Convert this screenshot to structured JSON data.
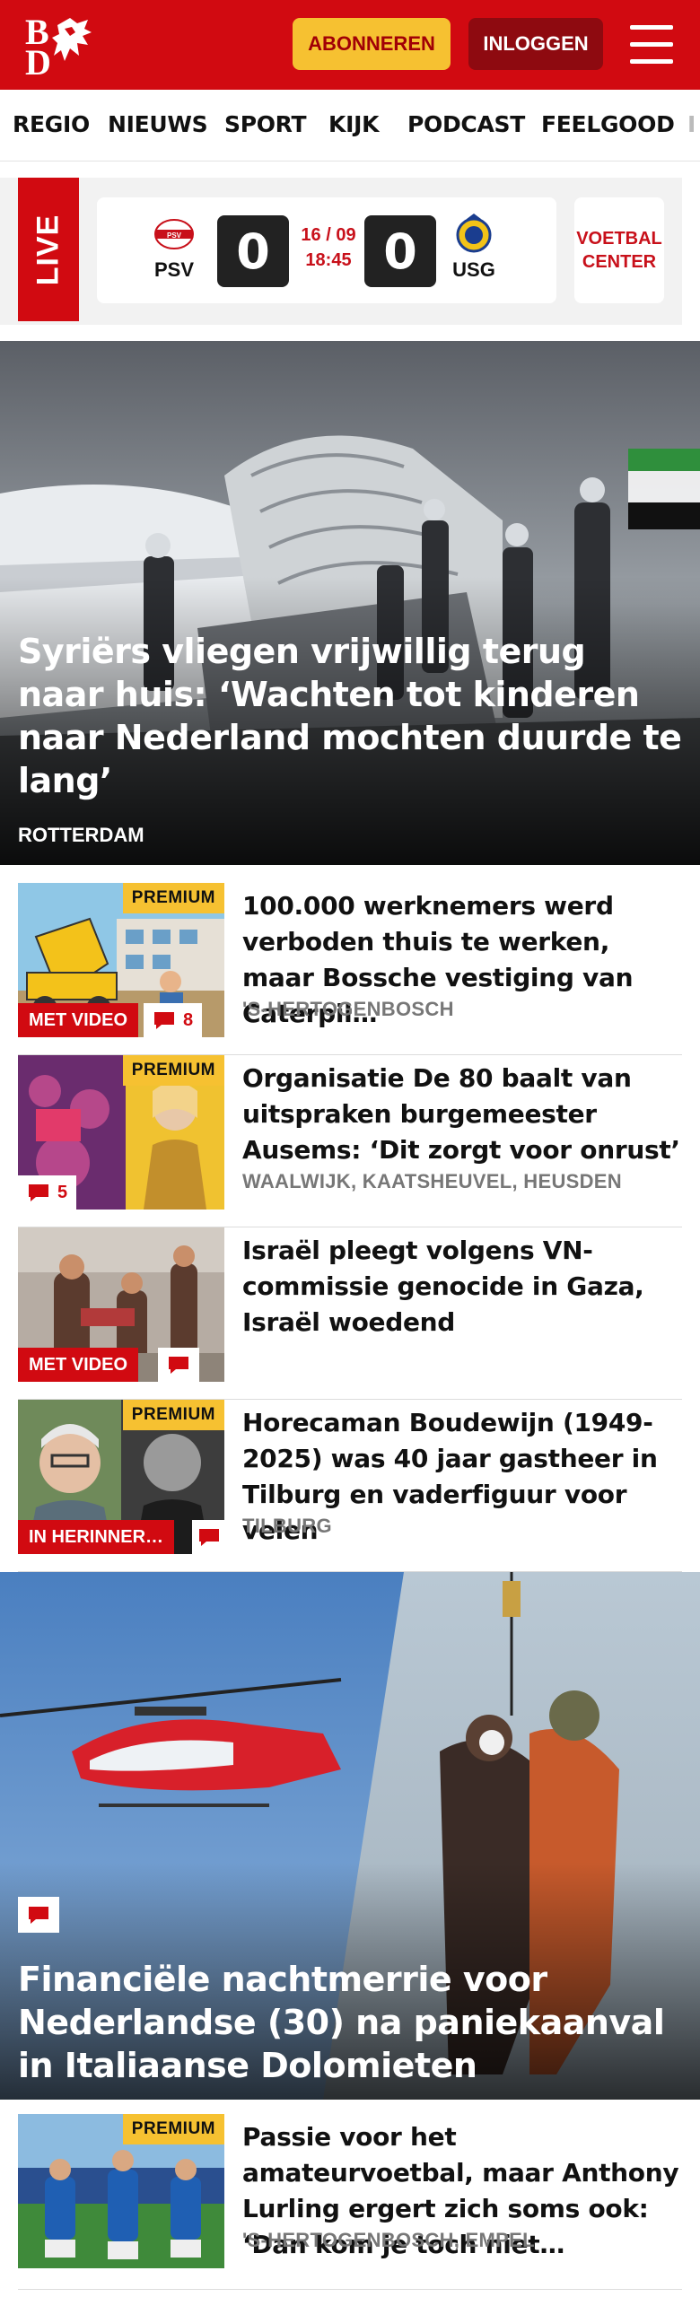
{
  "header": {
    "logo_text": "BD",
    "subscribe_label": "ABONNEREN",
    "login_label": "INLOGGEN"
  },
  "nav": {
    "items": [
      "REGIO",
      "NIEUWS",
      "SPORT",
      "KIJK",
      "PODCAST",
      "FEELGOOD",
      "I"
    ]
  },
  "live": {
    "label": "LIVE",
    "home_team": "PSV",
    "home_score": "0",
    "away_team": "USG",
    "away_score": "0",
    "date": "16 / 09",
    "time": "18:45",
    "voetbal_center": "VOETBAL CENTER"
  },
  "hero": {
    "title": "Syriërs vliegen vrijwillig terug naar huis: ‘Wachten tot kinderen naar Nederland mochten duurde te lang’",
    "location": "ROTTERDAM"
  },
  "articles": [
    {
      "premium": "PREMIUM",
      "badge": "MET VIDEO",
      "comments": "8",
      "title": "100.000 werknemers werd verboden thuis te werken, maar Bossche vestiging van Caterpil…",
      "location": "'S-HERTOGENBOSCH"
    },
    {
      "premium": "PREMIUM",
      "comments": "5",
      "title": "Organisatie De 80 baalt van uitspraken burgemeester Ausems: ‘Dit zorgt voor onrust’",
      "location": "WAALWIJK, KAATSHEUVEL, HEUSDEN"
    },
    {
      "badge": "MET VIDEO",
      "title": "Israël pleegt volgens VN-commissie genocide in Gaza, Israël woedend",
      "location": ""
    },
    {
      "premium": "PREMIUM",
      "badge": "IN HERINNER…",
      "title": "Horecaman Boudewijn (1949-2025) was 40 jaar gastheer in Tilburg en vaderfiguur voor velen",
      "location": "TILBURG"
    }
  ],
  "hero2": {
    "title": "Financiële nachtmerrie voor Nederlandse (30) na paniekaanval in Italiaanse Dolomieten"
  },
  "article_last": {
    "premium": "PREMIUM",
    "title": "Passie voor het amateurvoetbal, maar Anthony Lurling ergert zich soms ook: ‘Dan kom je toch niet…",
    "location": "'S-HERTOGENBOSCH, EMPEL"
  },
  "colors": {
    "brand_red": "#d10a11",
    "premium_yellow": "#f6c131",
    "login_dark_red": "#8e0a10"
  }
}
